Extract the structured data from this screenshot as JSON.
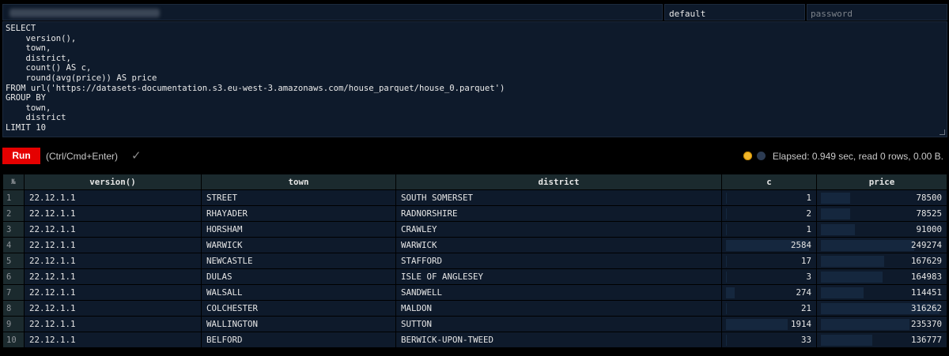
{
  "connection": {
    "user": "default",
    "password_placeholder": "password"
  },
  "query": "SELECT\n    version(),\n    town,\n    district,\n    count() AS c,\n    round(avg(price)) AS price\nFROM url('https://datasets-documentation.s3.eu-west-3.amazonaws.com/house_parquet/house_0.parquet')\nGROUP BY\n    town,\n    district\nLIMIT 10",
  "controls": {
    "run_label": "Run",
    "shortcut_hint": "(Ctrl/Cmd+Enter)",
    "check_mark": "✓",
    "elapsed": "Elapsed: 0.949 sec, read 0 rows, 0.00 B.",
    "theme_light_icon": "sun-icon",
    "theme_dark_icon": "moon-icon"
  },
  "table": {
    "rownum_header": "№",
    "columns": [
      "version()",
      "town",
      "district",
      "c",
      "price"
    ],
    "rows": [
      [
        "22.12.1.1",
        "STREET",
        "SOUTH SOMERSET",
        "1",
        "78500"
      ],
      [
        "22.12.1.1",
        "RHAYADER",
        "RADNORSHIRE",
        "2",
        "78525"
      ],
      [
        "22.12.1.1",
        "HORSHAM",
        "CRAWLEY",
        "1",
        "91000"
      ],
      [
        "22.12.1.1",
        "WARWICK",
        "WARWICK",
        "2584",
        "249274"
      ],
      [
        "22.12.1.1",
        "NEWCASTLE",
        "STAFFORD",
        "17",
        "167629"
      ],
      [
        "22.12.1.1",
        "DULAS",
        "ISLE OF ANGLESEY",
        "3",
        "164983"
      ],
      [
        "22.12.1.1",
        "WALSALL",
        "SANDWELL",
        "274",
        "114451"
      ],
      [
        "22.12.1.1",
        "COLCHESTER",
        "MALDON",
        "21",
        "316262"
      ],
      [
        "22.12.1.1",
        "WALLINGTON",
        "SUTTON",
        "1914",
        "235370"
      ],
      [
        "22.12.1.1",
        "BELFORD",
        "BERWICK-UPON-TWEED",
        "33",
        "136777"
      ]
    ]
  },
  "colors": {
    "background": "#000000",
    "panel": "#0e1a2b",
    "header": "#1b2a2e",
    "run_button": "#e50000",
    "bar": "#15273e"
  }
}
